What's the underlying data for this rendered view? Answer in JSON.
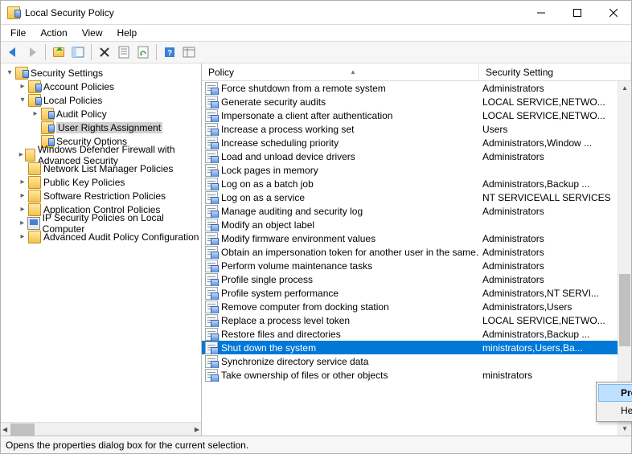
{
  "window": {
    "title": "Local Security Policy"
  },
  "menu": {
    "file": "File",
    "action": "Action",
    "view": "View",
    "help": "Help"
  },
  "tree": {
    "root": "Security Settings",
    "items": [
      {
        "label": "Account Policies",
        "expander": "▸",
        "indent": 2,
        "icon": "folder-sec"
      },
      {
        "label": "Local Policies",
        "expander": "▾",
        "indent": 2,
        "icon": "folder-sec"
      },
      {
        "label": "Audit Policy",
        "expander": "▸",
        "indent": 3,
        "icon": "folder-sec"
      },
      {
        "label": "User Rights Assignment",
        "expander": "",
        "indent": 3,
        "icon": "folder-sec",
        "selected": true
      },
      {
        "label": "Security Options",
        "expander": "",
        "indent": 3,
        "icon": "folder-sec"
      },
      {
        "label": "Windows Defender Firewall with Advanced Security",
        "expander": "▸",
        "indent": 2,
        "icon": "folder"
      },
      {
        "label": "Network List Manager Policies",
        "expander": "",
        "indent": 2,
        "icon": "folder"
      },
      {
        "label": "Public Key Policies",
        "expander": "▸",
        "indent": 2,
        "icon": "folder"
      },
      {
        "label": "Software Restriction Policies",
        "expander": "▸",
        "indent": 2,
        "icon": "folder"
      },
      {
        "label": "Application Control Policies",
        "expander": "▸",
        "indent": 2,
        "icon": "folder"
      },
      {
        "label": "IP Security Policies on Local Computer",
        "expander": "▸",
        "indent": 2,
        "icon": "pc"
      },
      {
        "label": "Advanced Audit Policy Configuration",
        "expander": "▸",
        "indent": 2,
        "icon": "folder"
      }
    ]
  },
  "list": {
    "col_policy": "Policy",
    "col_setting": "Security Setting",
    "rows": [
      {
        "policy": "Force shutdown from a remote system",
        "setting": "Administrators"
      },
      {
        "policy": "Generate security audits",
        "setting": "LOCAL SERVICE,NETWO..."
      },
      {
        "policy": "Impersonate a client after authentication",
        "setting": "LOCAL SERVICE,NETWO..."
      },
      {
        "policy": "Increase a process working set",
        "setting": "Users"
      },
      {
        "policy": "Increase scheduling priority",
        "setting": "Administrators,Window ..."
      },
      {
        "policy": "Load and unload device drivers",
        "setting": "Administrators"
      },
      {
        "policy": "Lock pages in memory",
        "setting": ""
      },
      {
        "policy": "Log on as a batch job",
        "setting": "Administrators,Backup ..."
      },
      {
        "policy": "Log on as a service",
        "setting": "NT SERVICE\\ALL SERVICES"
      },
      {
        "policy": "Manage auditing and security log",
        "setting": "Administrators"
      },
      {
        "policy": "Modify an object label",
        "setting": ""
      },
      {
        "policy": "Modify firmware environment values",
        "setting": "Administrators"
      },
      {
        "policy": "Obtain an impersonation token for another user in the same...",
        "setting": "Administrators"
      },
      {
        "policy": "Perform volume maintenance tasks",
        "setting": "Administrators"
      },
      {
        "policy": "Profile single process",
        "setting": "Administrators"
      },
      {
        "policy": "Profile system performance",
        "setting": "Administrators,NT SERVI..."
      },
      {
        "policy": "Remove computer from docking station",
        "setting": "Administrators,Users"
      },
      {
        "policy": "Replace a process level token",
        "setting": "LOCAL SERVICE,NETWO..."
      },
      {
        "policy": "Restore files and directories",
        "setting": "Administrators,Backup ..."
      },
      {
        "policy": "Shut down the system",
        "setting": "ministrators,Users,Ba...",
        "selected": true
      },
      {
        "policy": "Synchronize directory service data",
        "setting": ""
      },
      {
        "policy": "Take ownership of files or other objects",
        "setting": "ministrators"
      }
    ]
  },
  "context_menu": {
    "properties": "Properties",
    "help": "Help"
  },
  "status": "Opens the properties dialog box for the current selection."
}
